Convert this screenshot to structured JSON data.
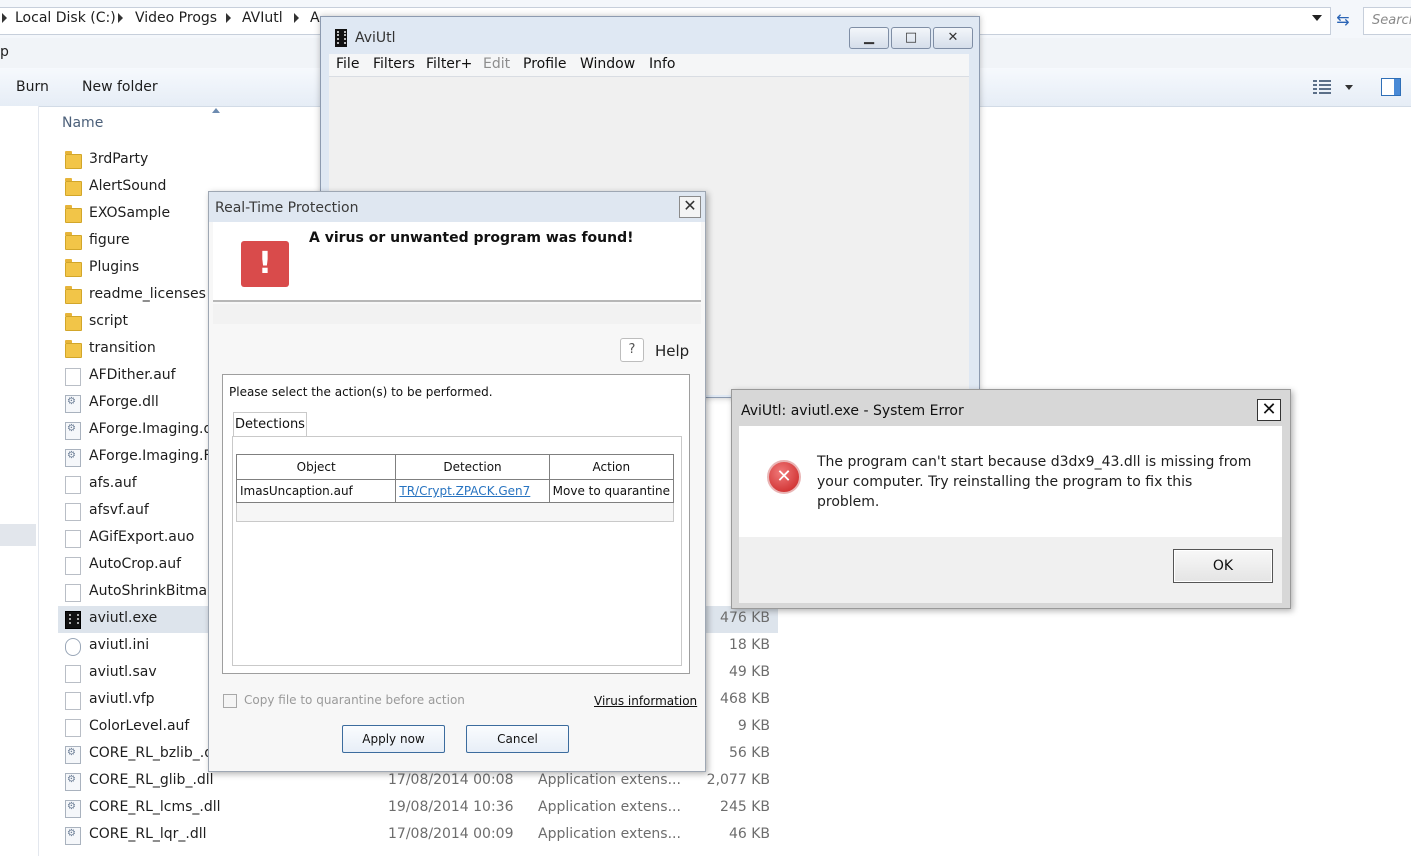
{
  "explorer": {
    "breadcrumbs": [
      "Local Disk (C:)",
      "Video Progs",
      "AVIutl",
      "A"
    ],
    "search_placeholder": "Search",
    "menu_fragment": "p",
    "toolbar": {
      "burn": "Burn",
      "new_folder": "New folder"
    },
    "column_name": "Name",
    "files": [
      {
        "name": "3rdParty",
        "icon": "folder-icon"
      },
      {
        "name": "AlertSound",
        "icon": "folder-icon"
      },
      {
        "name": "EXOSample",
        "icon": "folder-icon"
      },
      {
        "name": "figure",
        "icon": "folder-icon"
      },
      {
        "name": "Plugins",
        "icon": "folder-icon"
      },
      {
        "name": "readme_licenses",
        "icon": "folder-icon"
      },
      {
        "name": "script",
        "icon": "folder-icon"
      },
      {
        "name": "transition",
        "icon": "folder-icon"
      },
      {
        "name": "AFDither.auf",
        "icon": "file-icon"
      },
      {
        "name": "AForge.dll",
        "icon": "dll-icon"
      },
      {
        "name": "AForge.Imaging.dl",
        "icon": "dll-icon"
      },
      {
        "name": "AForge.Imaging.Fo",
        "icon": "dll-icon"
      },
      {
        "name": "afs.auf",
        "icon": "file-icon"
      },
      {
        "name": "afsvf.auf",
        "icon": "file-icon"
      },
      {
        "name": "AGifExport.auo",
        "icon": "file-icon"
      },
      {
        "name": "AutoCrop.auf",
        "icon": "file-icon"
      },
      {
        "name": "AutoShrinkBitmap",
        "icon": "file-icon"
      },
      {
        "name": "aviutl.exe",
        "icon": "exe-icon",
        "size": "476 KB",
        "selected": true
      },
      {
        "name": "aviutl.ini",
        "icon": "ini-icon",
        "size": "18 KB"
      },
      {
        "name": "aviutl.sav",
        "icon": "file-icon",
        "size": "49 KB"
      },
      {
        "name": "aviutl.vfp",
        "icon": "file-icon",
        "size": "468 KB"
      },
      {
        "name": "ColorLevel.auf",
        "icon": "file-icon",
        "size": "9 KB"
      },
      {
        "name": "CORE_RL_bzlib_.dl",
        "icon": "dll-icon",
        "size": "56 KB"
      },
      {
        "name": "CORE_RL_glib_.dll",
        "icon": "dll-icon",
        "date": "17/08/2014 00:08",
        "type": "Application extens...",
        "size": "2,077 KB"
      },
      {
        "name": "CORE_RL_lcms_.dll",
        "icon": "dll-icon",
        "date": "19/08/2014 10:36",
        "type": "Application extens...",
        "size": "245 KB"
      },
      {
        "name": "CORE_RL_lqr_.dll",
        "icon": "dll-icon",
        "date": "17/08/2014 00:09",
        "type": "Application extens...",
        "size": "46 KB"
      }
    ]
  },
  "aviutl": {
    "title": "AviUtl",
    "menu": [
      "File",
      "Filters",
      "Filter+",
      "Edit",
      "Profile",
      "Window",
      "Info"
    ],
    "disabled_menu": "Edit"
  },
  "rtp": {
    "title": "Real-Time Protection",
    "message": "A virus or unwanted program was found!",
    "help": "Help",
    "prompt": "Please select the action(s) to be performed.",
    "tab": "Detections",
    "columns": [
      "Object",
      "Detection",
      "Action"
    ],
    "rows": [
      {
        "object": "ImasUncaption.auf",
        "detection": "TR/Crypt.ZPACK.Gen7",
        "action": "Move to quarantine"
      }
    ],
    "copy_label": "Copy file to quarantine before action",
    "virus_info": "Virus information",
    "apply": "Apply now",
    "cancel": "Cancel",
    "alert_color": "#d94b4b"
  },
  "syserr": {
    "title": "AviUtl: aviutl.exe - System Error",
    "message": "The program can't start because d3dx9_43.dll is missing from your computer. Try reinstalling the program to fix this problem.",
    "ok": "OK"
  }
}
